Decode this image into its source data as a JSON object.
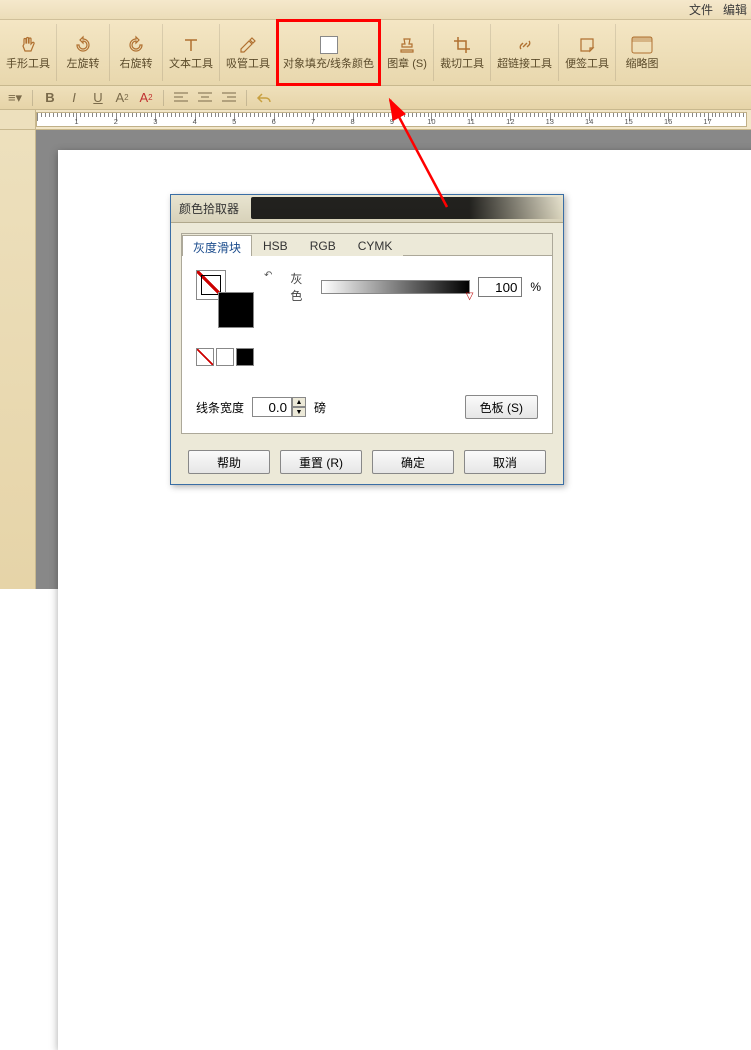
{
  "menubar": {
    "file": "文件",
    "edit": "编辑"
  },
  "ribbon": {
    "hand": "手形工具",
    "rotate_left": "左旋转",
    "rotate_right": "右旋转",
    "text": "文本工具",
    "eyedropper": "吸管工具",
    "fill_stroke": "对象填充/线条颜色",
    "stamp": "图章 (S)",
    "crop": "裁切工具",
    "hyperlink": "超链接工具",
    "sticky": "便签工具",
    "thumbnail": "缩略图"
  },
  "ruler": {
    "marks": [
      1,
      2,
      3,
      4,
      5,
      6,
      7,
      8,
      9,
      10,
      11,
      12,
      13,
      14,
      15,
      16,
      17
    ]
  },
  "dialog": {
    "title": "颜色拾取器",
    "tabs": {
      "gray": "灰度滑块",
      "hsb": "HSB",
      "rgb": "RGB",
      "cmyk": "CYMK"
    },
    "gray_label": "灰色",
    "percent": "%",
    "value": "100",
    "linewidth_label": "线条宽度",
    "linewidth_value": "0.0",
    "linewidth_unit": "磅",
    "palette_btn": "色板 (S)",
    "help": "帮助",
    "reset": "重置 (R)",
    "ok": "确定",
    "cancel": "取消"
  },
  "colors": {
    "highlight": "#ff0000",
    "accent": "#1a4b8c"
  }
}
